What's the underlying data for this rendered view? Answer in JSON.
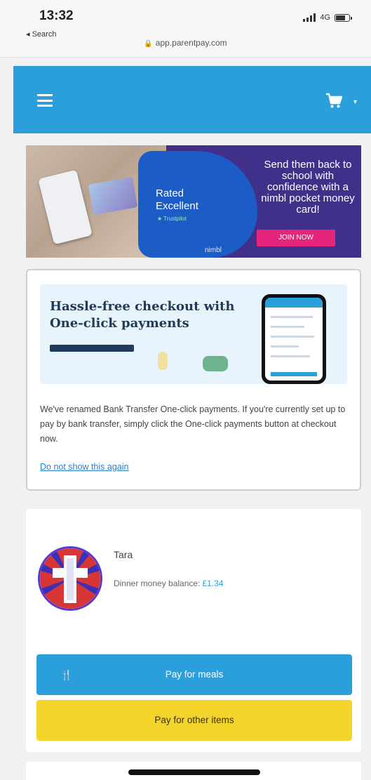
{
  "status_bar": {
    "time": "13:32",
    "back_label": "◂ Search",
    "network": "4G"
  },
  "browser": {
    "url": "app.parentpay.com"
  },
  "header": {
    "menu_icon": "hamburger-icon",
    "cart_icon": "cart-icon",
    "cart_caret": "▾",
    "color": "#2b9fdc"
  },
  "promo": {
    "rated": "Rated Excellent",
    "trustpilot": "★ Trustpilot",
    "headline": "Send them back to school with confidence with a nimbl pocket money card!",
    "cta": "JOIN NOW",
    "brand": "nimbl",
    "cta_color": "#e5257b"
  },
  "notice": {
    "title": "Hassle-free checkout with One-click payments",
    "body": "We've renamed Bank Transfer One-click payments. If you're currently set up to pay by bank transfer, simply click the One-click payments button at checkout now.",
    "dismiss_link": "Do not show this again"
  },
  "child": {
    "name": "Tara",
    "balance_label": "Dinner money balance:",
    "balance_amount": "£1.34",
    "pay_meals_label": "Pay for meals",
    "pay_other_label": "Pay for other items",
    "meals_icon": "fork-knife-icon",
    "meals_color": "#2b9fdc",
    "other_color": "#f2d42a"
  }
}
